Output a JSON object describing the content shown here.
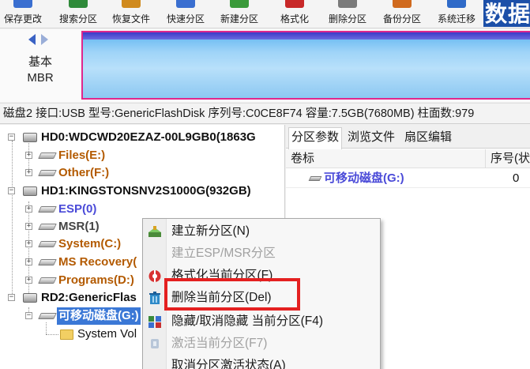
{
  "toolbar": {
    "buttons": [
      {
        "label": "保存更改",
        "icon": "save-icon",
        "color": "#3a6fd0"
      },
      {
        "label": "搜索分区",
        "icon": "search-partition-icon",
        "color": "#2f8a3a"
      },
      {
        "label": "恢复文件",
        "icon": "recover-file-icon",
        "color": "#d08a1e"
      },
      {
        "label": "快速分区",
        "icon": "quick-partition-icon",
        "color": "#3a6fd0"
      },
      {
        "label": "新建分区",
        "icon": "new-partition-icon",
        "color": "#3a9a3a"
      },
      {
        "label": "格式化",
        "icon": "format-icon",
        "color": "#c82828"
      },
      {
        "label": "删除分区",
        "icon": "delete-partition-icon",
        "color": "#7a7a7a"
      },
      {
        "label": "备份分区",
        "icon": "backup-partition-icon",
        "color": "#d06a1e"
      },
      {
        "label": "系统迁移",
        "icon": "system-migrate-icon",
        "color": "#2f6ac8"
      }
    ],
    "brand_text": "数据"
  },
  "disk_bar": {
    "disk_type_line1": "基本",
    "disk_type_line2": "MBR"
  },
  "disk_info": "磁盘2 接口:USB  型号:GenericFlashDisk  序列号:C0CE8F74  容量:7.5GB(7680MB)  柱面数:979",
  "tree": {
    "disks": [
      {
        "label": "HD0:WDCWD20EZAZ-00L9GB0(1863G"
      },
      {
        "label": "HD1:KINGSTONSNV2S1000G(932GB)"
      },
      {
        "label": "RD2:GenericFlas"
      }
    ],
    "partitions": [
      {
        "label": "Files(E:)"
      },
      {
        "label": "Other(F:)"
      },
      {
        "label": "ESP(0)"
      },
      {
        "label": "MSR(1)"
      },
      {
        "label": "System(C:)"
      },
      {
        "label": "MS Recovery("
      },
      {
        "label": "Programs(D:)"
      },
      {
        "label": "可移动磁盘(G:)"
      }
    ],
    "folder_label": "System Vol"
  },
  "right_panel": {
    "tabs": [
      "分区参数",
      "浏览文件",
      "扇区编辑"
    ],
    "columns": {
      "volume": "卷标",
      "index": "序号(状"
    },
    "row": {
      "name": "可移动磁盘(G:)",
      "index": "0"
    }
  },
  "context_menu": {
    "items": [
      {
        "label": "建立新分区(N)",
        "icon": "new-partition-icon",
        "disabled": false
      },
      {
        "label": "建立ESP/MSR分区",
        "icon": "esp-msr-icon",
        "disabled": true
      },
      {
        "label": "格式化当前分区(F)",
        "icon": "format-icon",
        "disabled": false
      },
      {
        "label": "删除当前分区(Del)",
        "icon": "trash-icon",
        "disabled": false
      },
      {
        "label": "隐藏/取消隐藏 当前分区(F4)",
        "icon": "hide-partition-icon",
        "disabled": false
      },
      {
        "label": "激活当前分区(F7)",
        "icon": "activate-partition-icon",
        "disabled": true
      },
      {
        "label": "取消分区激活状态(A)",
        "icon": "deactivate-partition-icon",
        "disabled": false
      }
    ]
  },
  "colors": {
    "selection": "#3b78d6",
    "highlight_border": "#e42020",
    "partition_orange": "#b35a00",
    "partition_blue": "#4a4ad8",
    "disk_bar_border": "#e0288c"
  }
}
